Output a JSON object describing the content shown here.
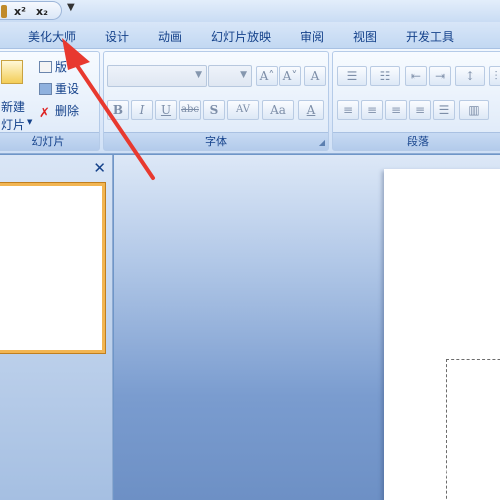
{
  "qat": {
    "superscript_label": "x²",
    "subscript_label": "x₂",
    "dropdown_glyph": "▼"
  },
  "tabs": [
    "美化大师",
    "设计",
    "动画",
    "幻灯片放映",
    "审阅",
    "视图",
    "开发工具"
  ],
  "ribbon": {
    "slides_group": {
      "label": "幻灯片",
      "new_slide_line1": "新建",
      "new_slide_line2": "灯片",
      "new_slide_caret": "▼",
      "layout_label": "版",
      "reset_label": "重设",
      "delete_label": "删除"
    },
    "font_group": {
      "label": "字体",
      "grow_font": "A˄",
      "shrink_font": "A˅",
      "clear_format": "A",
      "bold": "B",
      "italic": "I",
      "underline": "U",
      "strike": "abc",
      "shadow": "S",
      "spacing": "AV",
      "case": "Aa",
      "color": "A"
    },
    "paragraph_group": {
      "label": "段落"
    }
  },
  "pane": {
    "close_glyph": "✕"
  },
  "colors": {
    "accent_orange": "#f2b552",
    "arrow_red": "#e8392f",
    "ribbon_text": "#15428b"
  }
}
